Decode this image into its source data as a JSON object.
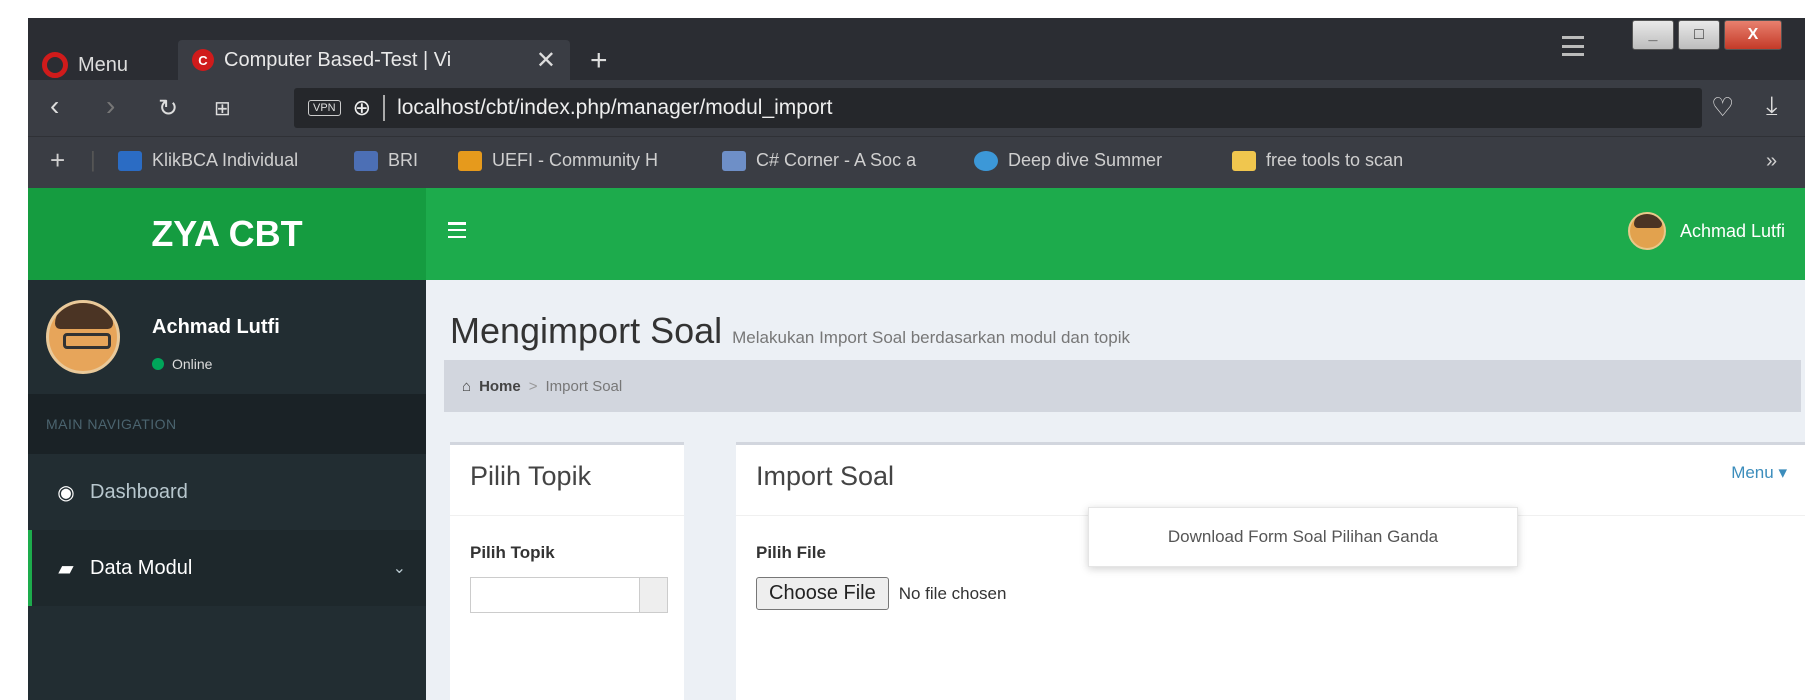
{
  "browser": {
    "opera_menu_label": "Menu",
    "tab_title": "Computer Based-Test | Vi",
    "tab_favicon_letter": "C",
    "url": "localhost/cbt/index.php/manager/modul_import",
    "window_controls": {
      "minimize": "_",
      "maximize": "□",
      "close": "X"
    },
    "bookmarks": [
      {
        "label": "KlikBCA Individual",
        "color": "#2b6cc4"
      },
      {
        "label": "BRI",
        "color": "#4c6fb5"
      },
      {
        "label": "UEFI - Community H",
        "color": "#e69a1c"
      },
      {
        "label": "C# Corner - A Soc a",
        "color": "#6e8fc7"
      },
      {
        "label": "Deep dive Summer",
        "color": "#3c98d8"
      },
      {
        "label": "free tools to scan",
        "color": "#f0c64e"
      }
    ],
    "bookmarks_overflow": "»"
  },
  "app": {
    "logo": "ZYA CBT",
    "header_user": "Achmad Lutfi",
    "sidebar": {
      "user_name": "Achmad Lutfi",
      "status": "Online",
      "nav_header": "MAIN NAVIGATION",
      "items": [
        {
          "label": "Dashboard",
          "icon": "dashboard-icon"
        },
        {
          "label": "Data Modul",
          "icon": "book-icon"
        }
      ]
    },
    "content": {
      "title": "Mengimport Soal",
      "subtitle": "Melakukan Import Soal berdasarkan modul dan topik",
      "breadcrumb": {
        "home": "Home",
        "current": "Import Soal"
      },
      "left_box": {
        "title": "Pilih Topik",
        "field_label": "Pilih Topik"
      },
      "right_box": {
        "title": "Import Soal",
        "menu_label": "Menu",
        "dropdown_item": "Download Form Soal Pilihan Ganda",
        "file_label": "Pilih File",
        "choose_file": "Choose File",
        "no_file": "No file chosen"
      }
    }
  },
  "colors": {
    "header_green": "#1dab4c",
    "logo_green": "#159c40",
    "sidebar_dark": "#222d32"
  }
}
